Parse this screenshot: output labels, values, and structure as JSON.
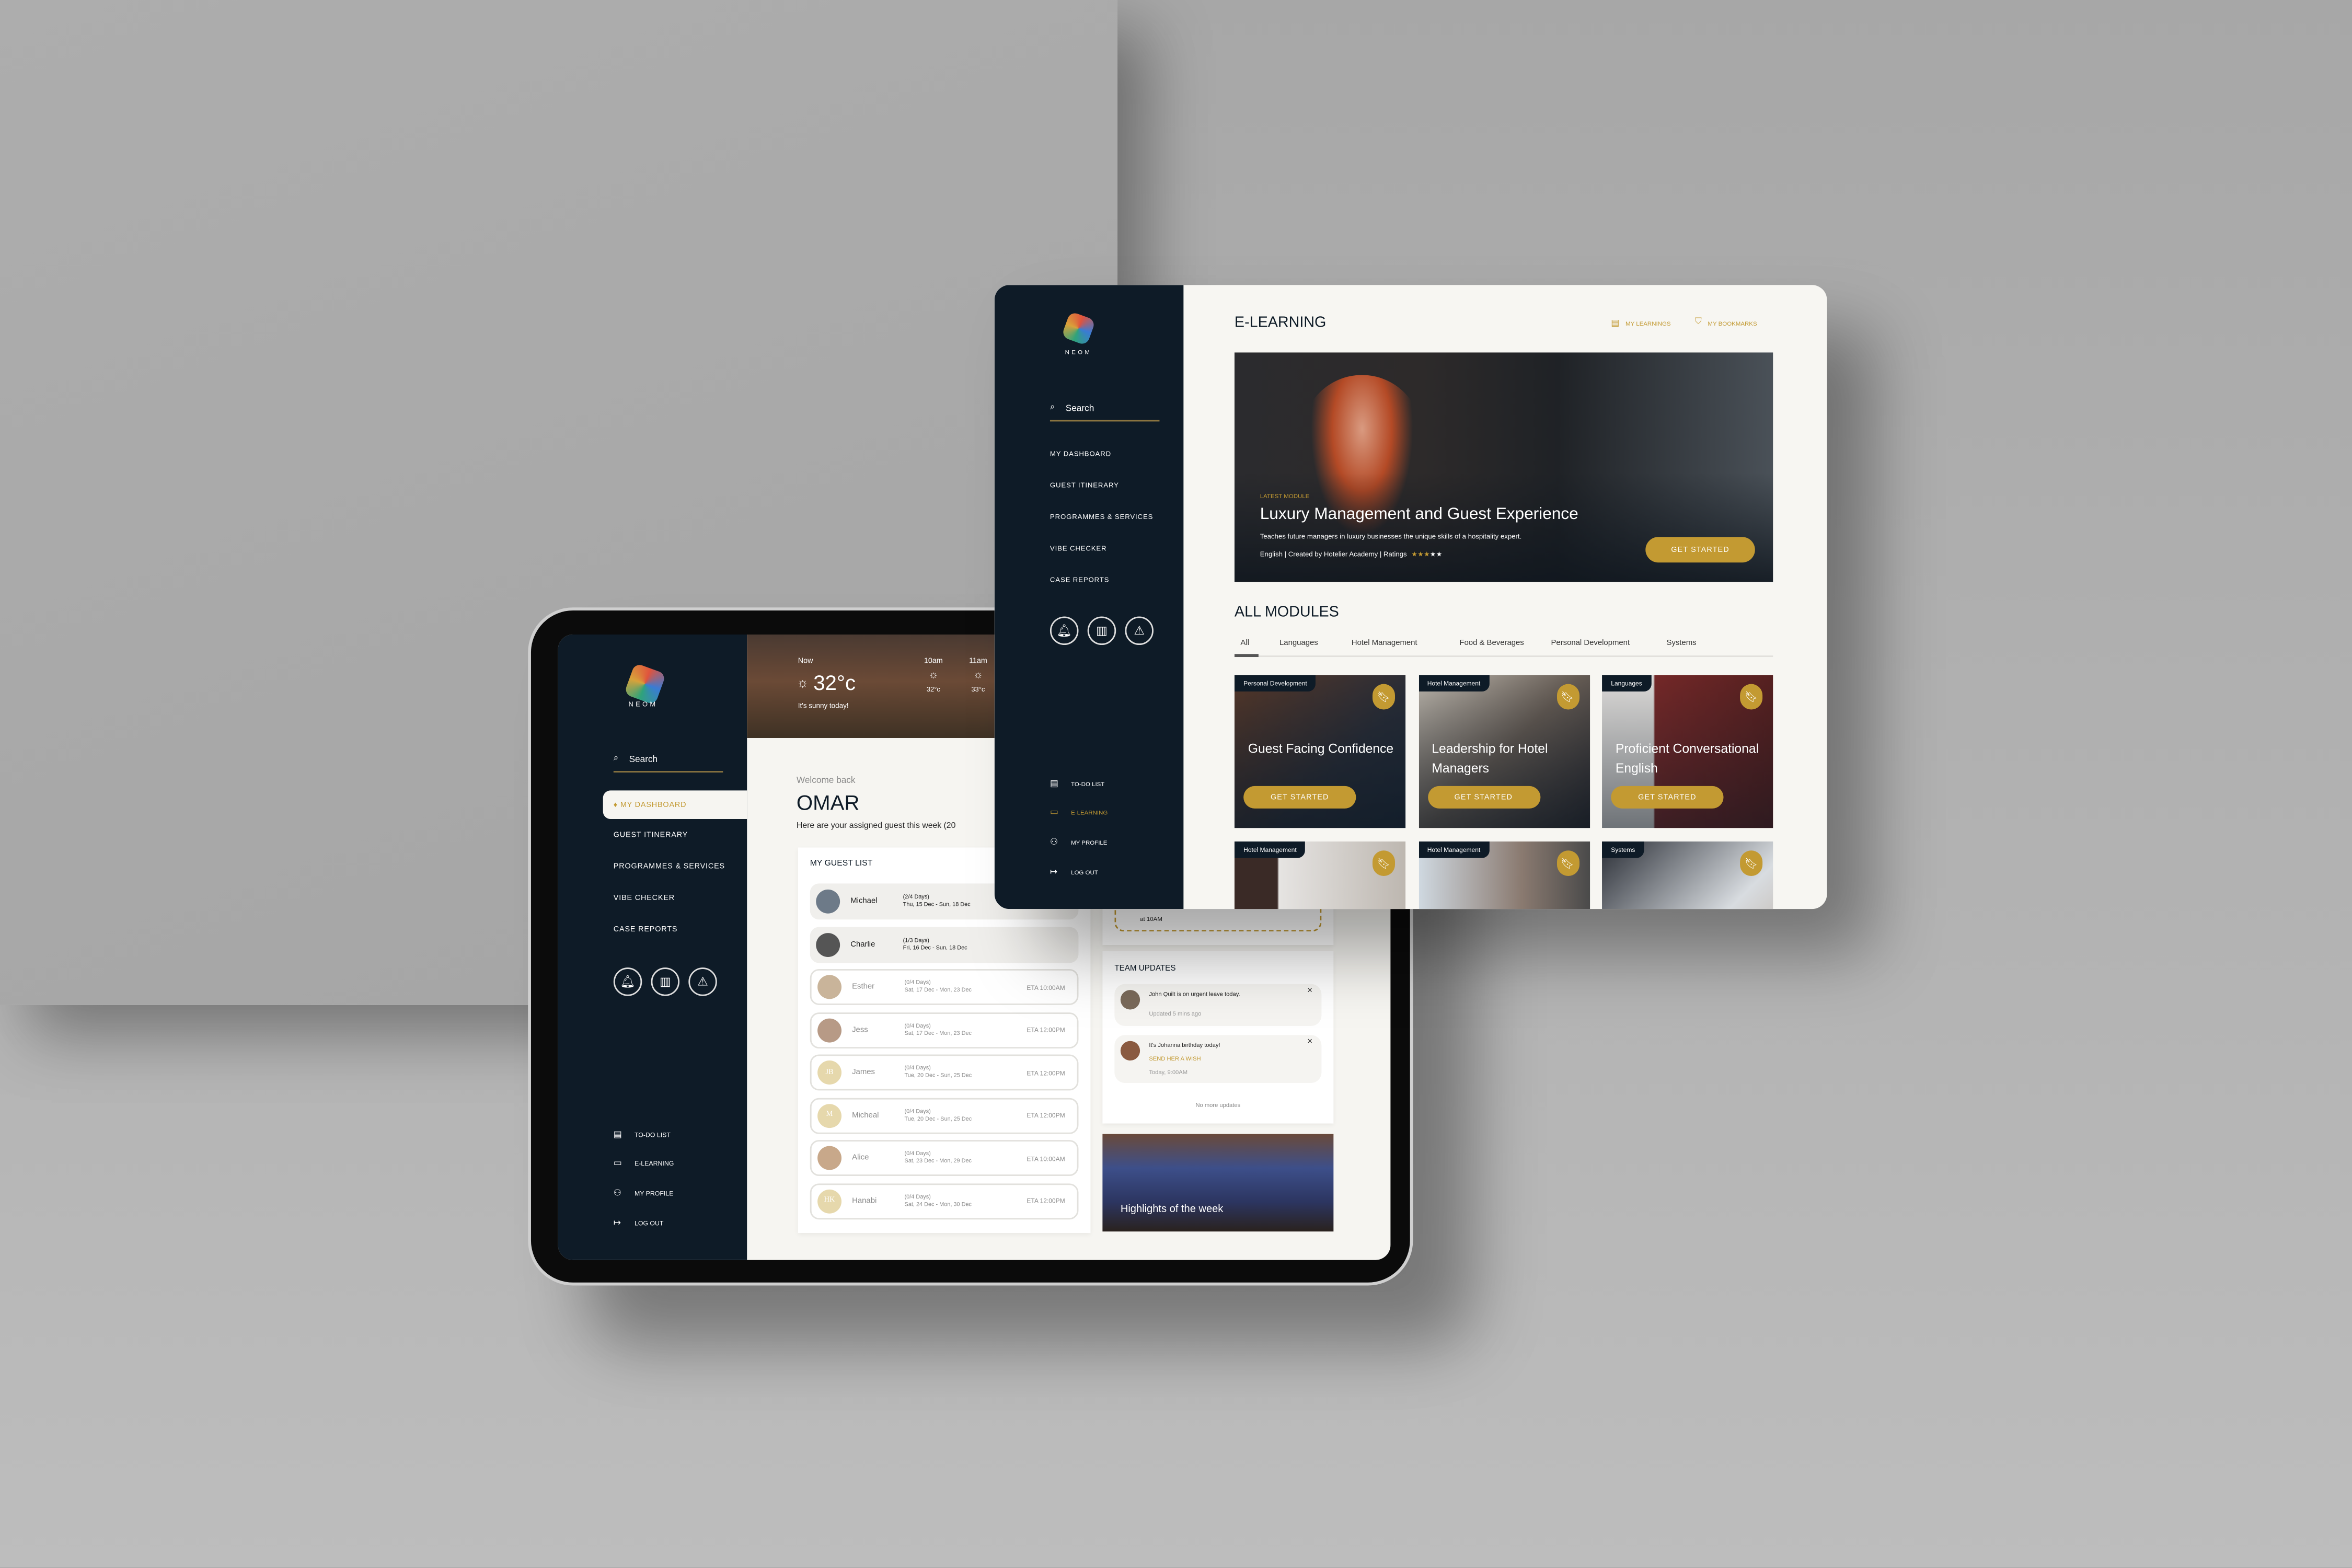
{
  "brand": {
    "logo_text": "NEOM"
  },
  "colors": {
    "accent": "#c39a32",
    "sidebar": "#0e1b27",
    "background": "#f7f6f2"
  },
  "sidebar": {
    "search_placeholder": "Search",
    "items": [
      "MY DASHBOARD",
      "GUEST ITINERARY",
      "PROGRAMMES & SERVICES",
      "VIBE CHECKER",
      "CASE REPORTS"
    ],
    "quick_icons": [
      "bell-icon",
      "map-icon",
      "alert-icon"
    ],
    "bottom_items": [
      {
        "label": "TO-DO LIST",
        "icon": "list-icon"
      },
      {
        "label": "E-LEARNING",
        "icon": "folder-icon"
      },
      {
        "label": "MY PROFILE",
        "icon": "user-icon"
      },
      {
        "label": "LOG OUT",
        "icon": "logout-icon"
      }
    ]
  },
  "dashboard": {
    "active_item": "MY DASHBOARD",
    "weather": {
      "now_label": "Now",
      "now_temp": "32°c",
      "summary": "It's sunny today!",
      "forecast": [
        {
          "time": "10am",
          "temp": "32°c"
        },
        {
          "time": "11am",
          "temp": "33°c"
        }
      ]
    },
    "welcome": "Welcome back",
    "user_name": "OMAR",
    "subtitle": "Here are your assigned guest this week (20",
    "guest_list": {
      "title": "MY GUEST LIST",
      "guests": [
        {
          "name": "Michael",
          "days": "(2/4 Days)",
          "dates": "Thu, 15 Dec - Sun, 18 Dec",
          "eta": "",
          "initials": "",
          "current": true
        },
        {
          "name": "Charlie",
          "days": "(1/3 Days)",
          "dates": "Fri, 16 Dec - Sun, 18 Dec",
          "eta": "",
          "initials": "",
          "current": true
        },
        {
          "name": "Esther",
          "days": "(0/4 Days)",
          "dates": "Sat, 17 Dec - Mon, 23 Dec",
          "eta": "ETA 10:00AM",
          "initials": "",
          "current": false
        },
        {
          "name": "Jess",
          "days": "(0/4 Days)",
          "dates": "Sat, 17 Dec - Mon, 23 Dec",
          "eta": "ETA 12:00PM",
          "initials": "",
          "current": false
        },
        {
          "name": "James",
          "days": "(0/4 Days)",
          "dates": "Tue, 20 Dec - Sun, 25 Dec",
          "eta": "ETA 12:00PM",
          "initials": "JB",
          "current": false
        },
        {
          "name": "Micheal",
          "days": "(0/4 Days)",
          "dates": "Tue, 20 Dec - Sun, 25 Dec",
          "eta": "ETA 12:00PM",
          "initials": "M",
          "current": false
        },
        {
          "name": "Alice",
          "days": "(0/4 Days)",
          "dates": "Sat, 23 Dec - Mon, 29 Dec",
          "eta": "ETA 10:00AM",
          "initials": "",
          "current": false
        },
        {
          "name": "Hanabi",
          "days": "(0/4 Days)",
          "dates": "Sat, 24 Dec - Mon, 30 Dec",
          "eta": "ETA 12:00PM",
          "initials": "HK",
          "current": false
        }
      ]
    },
    "task_partial": "at 10AM",
    "team_updates": {
      "title": "TEAM UPDATES",
      "items": [
        {
          "text": "John Quilt is on urgent leave today.",
          "action": "",
          "time": "Updated 5 mins ago"
        },
        {
          "text": "It's Johanna birthday today!",
          "action": "SEND HER A WISH",
          "time": "Today, 9:00AM"
        }
      ],
      "footer": "No more updates"
    },
    "highlights": "Highlights of the week"
  },
  "elearning": {
    "active_item": "E-LEARNING",
    "title": "E-LEARNING",
    "links": [
      "MY LEARNINGS",
      "MY BOOKMARKS"
    ],
    "hero": {
      "eyebrow": "LATEST MODULE",
      "title": "Luxury Management and Guest Experience",
      "description": "Teaches future managers in luxury businesses the unique skills of a hospitality expert.",
      "meta": "English | Created by Hotelier Academy | Ratings",
      "rating": 3,
      "rating_max": 5,
      "cta": "GET STARTED"
    },
    "modules_title": "ALL MODULES",
    "tabs": [
      "All",
      "Languages",
      "Hotel Management",
      "Food & Beverages",
      "Personal Development",
      "Systems"
    ],
    "active_tab": "All",
    "modules": [
      {
        "category": "Personal Development",
        "title": "Guest Facing Confidence",
        "cta": "GET STARTED"
      },
      {
        "category": "Hotel Management",
        "title": "Leadership for Hotel Managers",
        "cta": "GET STARTED"
      },
      {
        "category": "Languages",
        "title": "Proficient Conversational English",
        "cta": "GET STARTED"
      },
      {
        "category": "Hotel Management",
        "title": "",
        "cta": ""
      },
      {
        "category": "Hotel Management",
        "title": "",
        "cta": ""
      },
      {
        "category": "Systems",
        "title": "",
        "cta": ""
      }
    ]
  }
}
